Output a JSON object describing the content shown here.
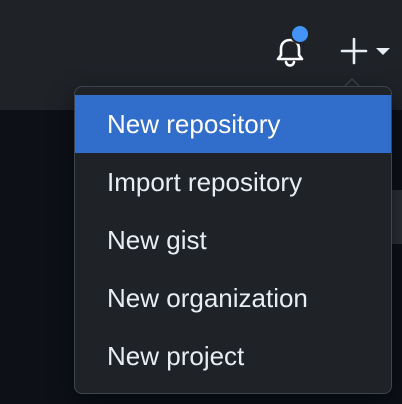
{
  "header": {
    "notifications_icon": "bell-icon",
    "has_unread": true,
    "unread_color": "#4493f8",
    "create_icon": "plus-icon",
    "create_caret_icon": "caret-down-icon"
  },
  "create_menu": {
    "items": [
      {
        "label": "New repository",
        "active": true
      },
      {
        "label": "Import repository",
        "active": false
      },
      {
        "label": "New gist",
        "active": false
      },
      {
        "label": "New organization",
        "active": false
      },
      {
        "label": "New project",
        "active": false
      }
    ],
    "highlight_color": "#316dca"
  }
}
